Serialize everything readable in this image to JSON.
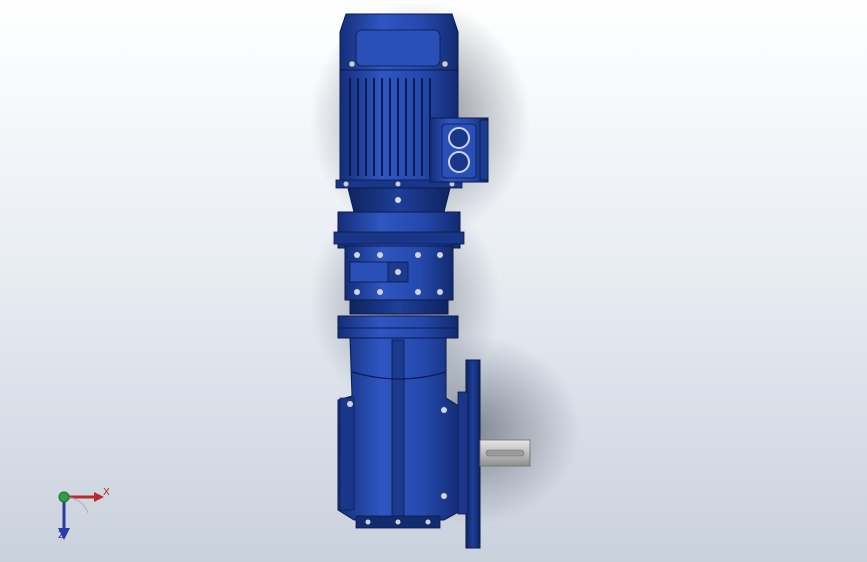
{
  "view": {
    "background_top": "#ffffff",
    "background_bottom": "#c9d1dc",
    "model_color": "#1f3f9a"
  },
  "triad": {
    "x_label": "X",
    "z_label": "Z",
    "x_color": "#c0282d",
    "y_color": "#2ea043",
    "z_color": "#2a3aa8"
  },
  "parts": [
    {
      "name": "motor-fan-cover-icon"
    },
    {
      "name": "motor-housing-icon"
    },
    {
      "name": "terminal-box-icon"
    },
    {
      "name": "motor-flange-icon"
    },
    {
      "name": "gear-stage-housing-icon"
    },
    {
      "name": "adapter-flange-icon"
    },
    {
      "name": "gearbox-housing-icon"
    },
    {
      "name": "output-flange-icon"
    },
    {
      "name": "output-shaft-icon"
    }
  ]
}
